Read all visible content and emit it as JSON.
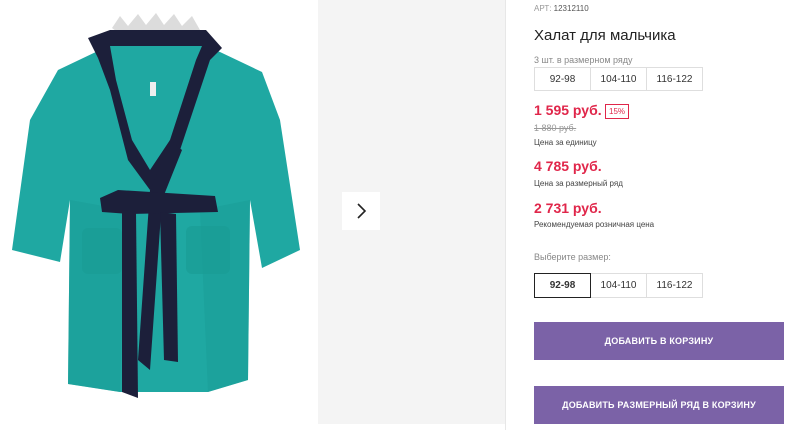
{
  "product": {
    "article_label": "АРТ:",
    "article_number": "12312110",
    "title": "Халат для мальчика",
    "image_alt": "product-photo"
  },
  "pack": {
    "label": "3 шт. в размерном ряду",
    "sizes": [
      "92-98",
      "104-110",
      "116-122"
    ]
  },
  "prices": {
    "unit_price": "1 595 руб.",
    "discount": "15%",
    "old_price": "1 880 руб.",
    "unit_caption": "Цена за единицу",
    "pack_price": "4 785 руб.",
    "pack_caption": "Цена за размерный ряд",
    "retail_price": "2 731 руб.",
    "retail_caption": "Рекомендуемая розничная цена"
  },
  "size_select": {
    "label": "Выберите размер:",
    "options": [
      "92-98",
      "104-110",
      "116-122"
    ],
    "selected": "92-98"
  },
  "buttons": {
    "add_to_cart": "ДОБАВИТЬ В КОРЗИНУ",
    "add_pack_to_cart": "ДОБАВИТЬ РАЗМЕРНЫЙ РЯД В КОРЗИНУ"
  },
  "colors": {
    "accent_red": "#e0264a",
    "button_purple": "#7b62a7",
    "robe_teal": "#1fa8a2",
    "robe_navy": "#1c1f3a"
  },
  "icons": {
    "next": "chevron-right-icon"
  }
}
